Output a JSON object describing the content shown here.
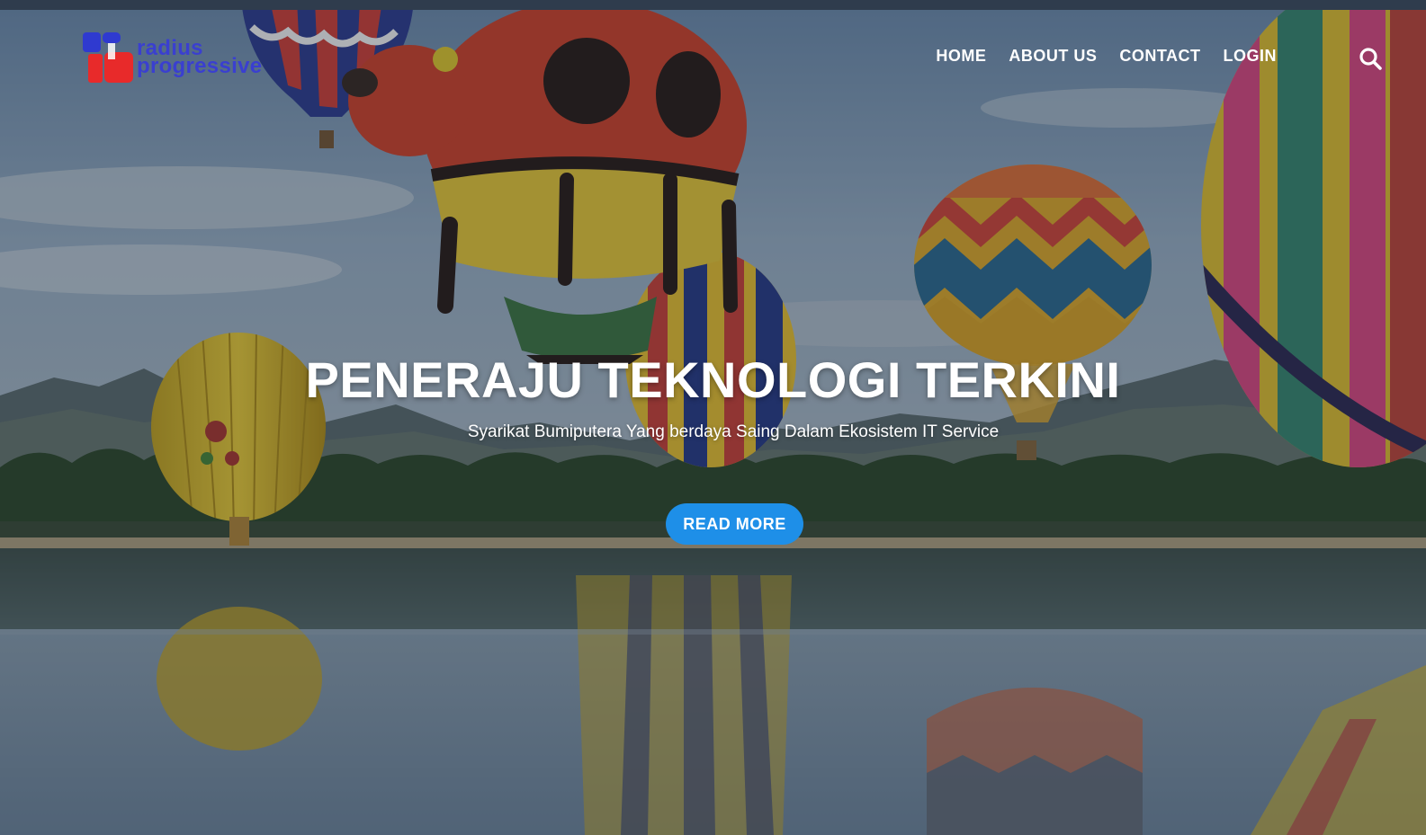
{
  "header": {
    "logo": {
      "line1": "radius",
      "line2": "progressive",
      "brand_color": "#3a3fd0",
      "mark_colors": [
        "#2f3ad0",
        "#e82a2a"
      ]
    },
    "nav": {
      "items": [
        {
          "label": "HOME"
        },
        {
          "label": "ABOUT US"
        },
        {
          "label": "CONTACT"
        },
        {
          "label": "LOGIN"
        }
      ]
    },
    "search_icon": "search-icon"
  },
  "hero": {
    "headline": "PENERAJU TEKNOLOGI TERKINI",
    "subheadline": "Syarikat Bumiputera Yang berdaya Saing Dalam Ekosistem IT Service",
    "cta_label": "READ MORE",
    "cta_color": "#1e8fe8",
    "background_image": "hot-air-balloons-over-lake"
  }
}
